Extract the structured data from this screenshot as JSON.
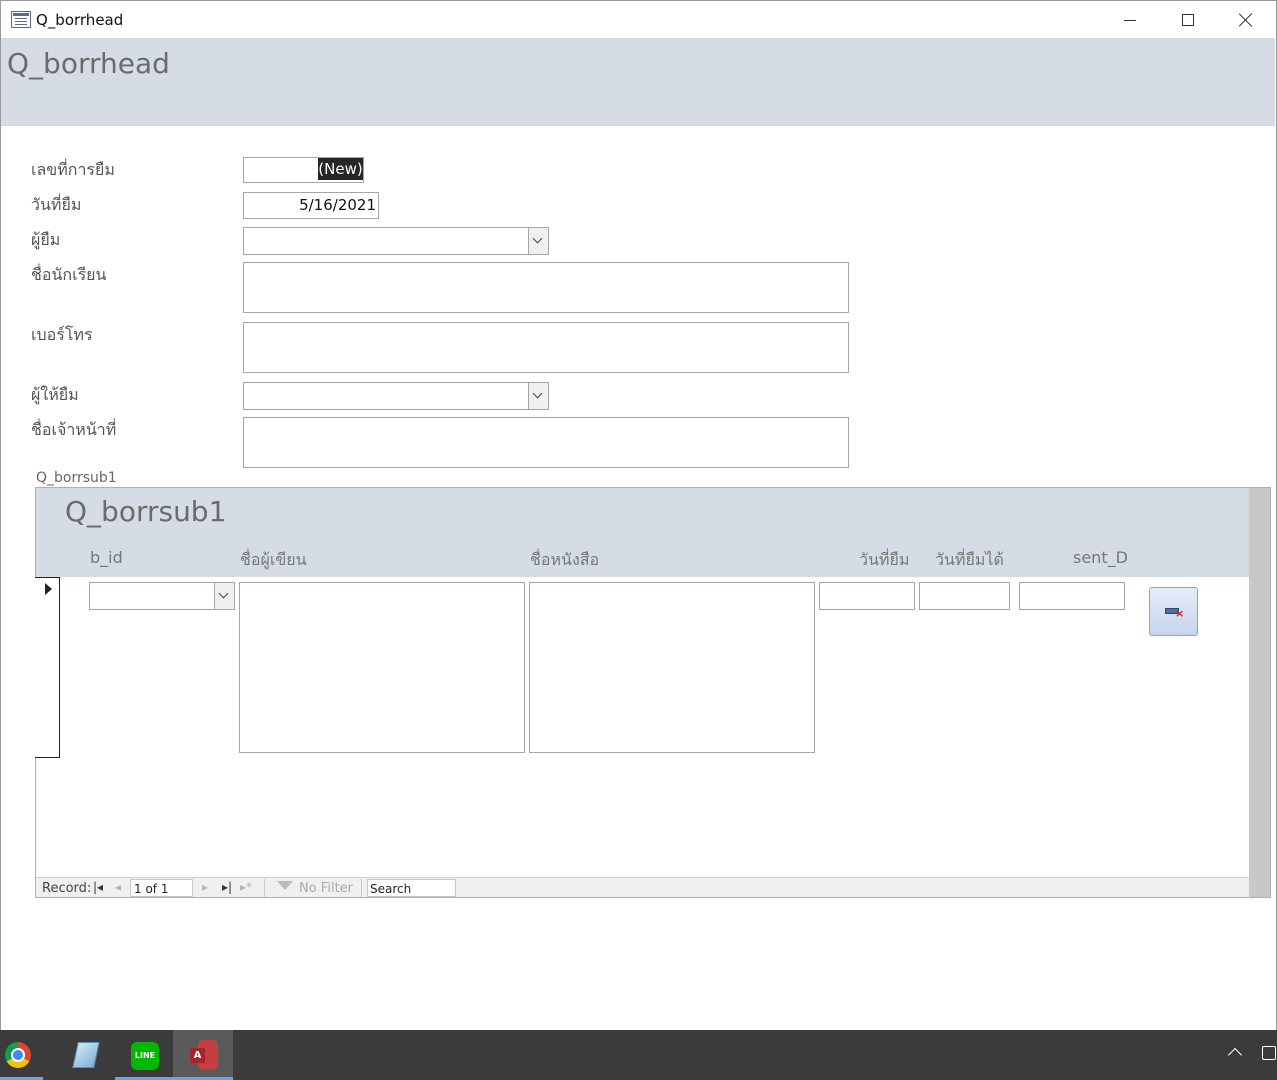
{
  "window": {
    "title": "Q_borrhead"
  },
  "form": {
    "title": "Q_borrhead",
    "fields": {
      "borrow_no": {
        "label": "เลขที่การยืม",
        "value": "(New)"
      },
      "borrow_date": {
        "label": "วันที่ยืม",
        "value": "5/16/2021"
      },
      "borrower": {
        "label": "ผู้ยืม",
        "value": ""
      },
      "student_name": {
        "label": "ชื่อนักเรียน",
        "value": ""
      },
      "phone": {
        "label": "เบอร์โทร",
        "value": ""
      },
      "lender": {
        "label": "ผู้ให้ยืม",
        "value": ""
      },
      "staff_name": {
        "label": "ชื่อเจ้าหน้าที่",
        "value": ""
      }
    }
  },
  "subform": {
    "caption": "Q_borrsub1",
    "title": "Q_borrsub1",
    "columns": [
      "b_id",
      "ชื่อผู้เขียน",
      "ชื่อหนังสือ",
      "วันที่ยืม",
      "วันที่ยืมได้",
      "sent_D"
    ],
    "record_nav": {
      "label": "Record:",
      "current": "1 of 1",
      "filter": "No Filter",
      "search": "Search"
    }
  },
  "taskbar": {
    "apps": [
      "chrome-icon",
      "sticky-notes-icon",
      "line-icon",
      "access-icon"
    ],
    "line_text": "LINE",
    "access_letter": "A"
  }
}
